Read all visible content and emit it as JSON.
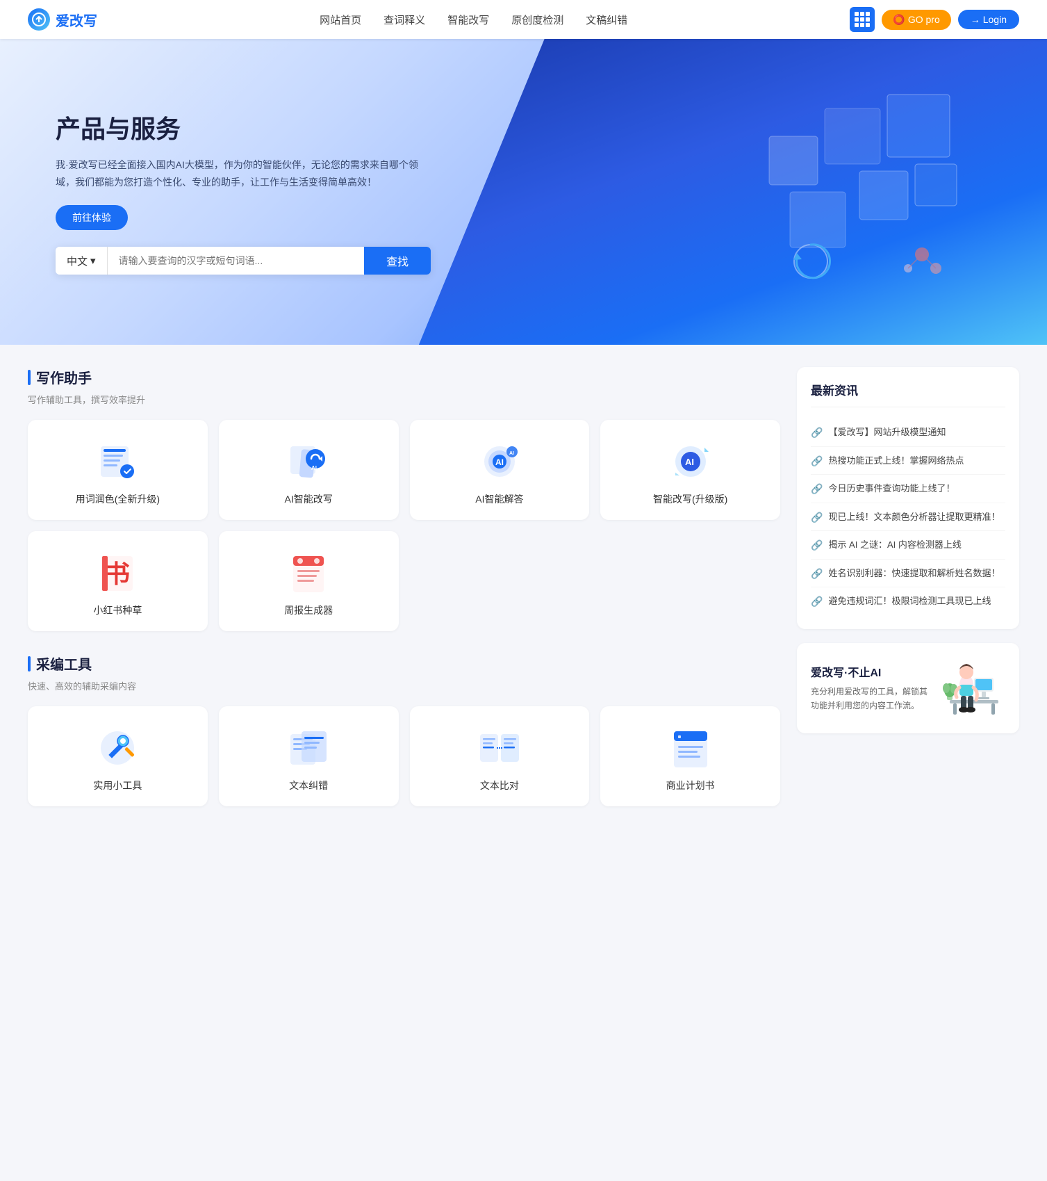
{
  "navbar": {
    "logo_text": "爱改写",
    "nav_items": [
      {
        "label": "网站首页",
        "href": "#"
      },
      {
        "label": "查词释义",
        "href": "#"
      },
      {
        "label": "智能改写",
        "href": "#"
      },
      {
        "label": "原创度检测",
        "href": "#"
      },
      {
        "label": "文稿纠错",
        "href": "#"
      }
    ],
    "btn_grid_label": "apps",
    "btn_go_label": "GO pro",
    "btn_login_label": "Login"
  },
  "hero": {
    "title": "产品与服务",
    "description": "我·爱改写已经全面接入国内AI大模型，作为你的智能伙伴，无论您的需求来自哪个领域，我们都能为您打造个性化、专业的助手，让工作与生活变得简单高效！",
    "btn_try": "前往体验",
    "search": {
      "lang": "中文",
      "placeholder": "请输入要查询的汉字或短句词语...",
      "btn_label": "查找"
    },
    "deco_circles": [
      {
        "color": "#e53935"
      },
      {
        "color": "#e57373"
      },
      {
        "color": "#ef9a9a"
      }
    ]
  },
  "writing_tools": {
    "section_title": "写作助手",
    "section_sub": "写作辅助工具，撰写效率提升",
    "tools": [
      {
        "id": "yongci",
        "label": "用词润色(全新升级)",
        "icon_type": "document-blue"
      },
      {
        "id": "ai-rewrite",
        "label": "AI智能改写",
        "icon_type": "ai-rewrite"
      },
      {
        "id": "ai-answer",
        "label": "AI智能解答",
        "icon_type": "ai-answer"
      },
      {
        "id": "smart-rewrite",
        "label": "智能改写(升级版)",
        "icon_type": "smart-rewrite"
      },
      {
        "id": "xiaohongshu",
        "label": "小红书种草",
        "icon_type": "book-red"
      },
      {
        "id": "weekly-report",
        "label": "周报生成器",
        "icon_type": "report-red"
      }
    ]
  },
  "editor_tools": {
    "section_title": "采编工具",
    "section_sub": "快速、高效的辅助采编内容",
    "tools": [
      {
        "id": "utils",
        "label": "实用小工具",
        "icon_type": "tools-blue"
      },
      {
        "id": "text-correct",
        "label": "文本纠错",
        "icon_type": "text-correct"
      },
      {
        "id": "text-compare",
        "label": "文本比对",
        "icon_type": "text-compare"
      },
      {
        "id": "business-plan",
        "label": "商业计划书",
        "icon_type": "business-plan"
      }
    ]
  },
  "news": {
    "panel_title": "最新资讯",
    "items": [
      {
        "text": "【爱改写】网站升级模型通知"
      },
      {
        "text": "热搜功能正式上线！掌握网络热点"
      },
      {
        "text": "今日历史事件查询功能上线了！"
      },
      {
        "text": "现已上线！文本颜色分析器让提取更精准！"
      },
      {
        "text": "揭示 AI 之谜：AI 内容检测器上线"
      },
      {
        "text": "姓名识别利器：快速提取和解析姓名数据！"
      },
      {
        "text": "避免违规词汇！极限词检测工具现已上线"
      }
    ]
  },
  "promo": {
    "title": "爱改写·不止AI",
    "description": "充分利用爱改写的工具，解锁其功能并利用您的内容工作流。"
  }
}
